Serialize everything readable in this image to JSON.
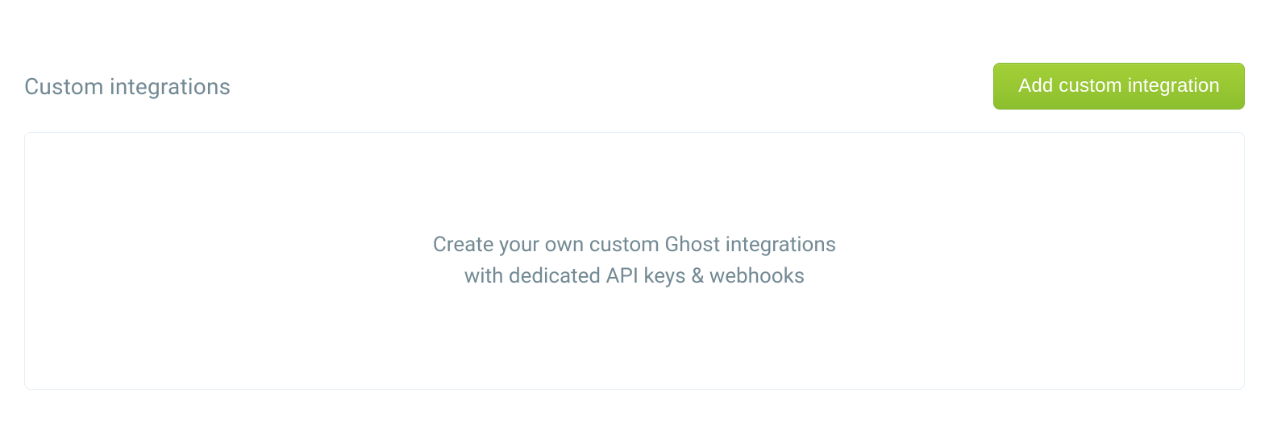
{
  "section": {
    "title": "Custom integrations",
    "add_button_label": "Add custom integration",
    "empty_line1": "Create your own custom Ghost integrations",
    "empty_line2": "with dedicated API keys & webhooks"
  }
}
